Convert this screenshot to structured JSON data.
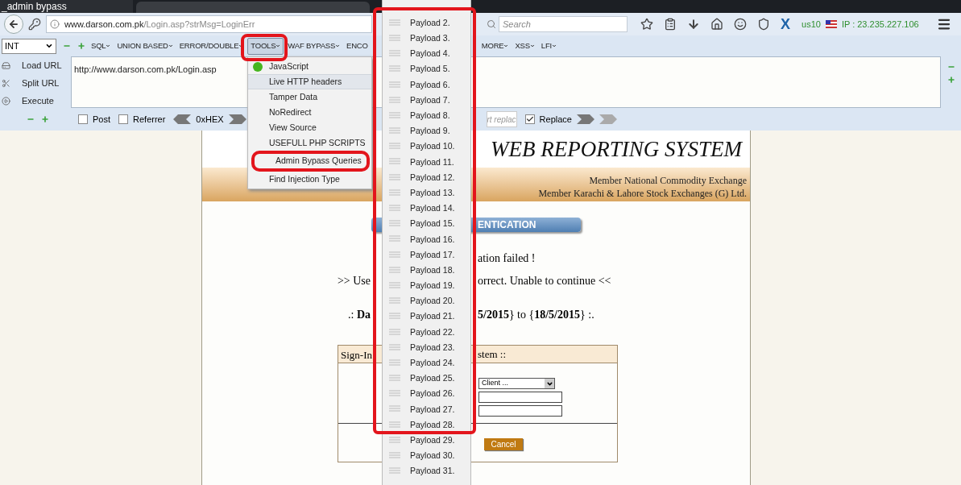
{
  "tab_title": "_admin bypass",
  "address_bar": {
    "host": "www.darson.com.pk",
    "path": "/Login.asp?strMsg=LoginErr"
  },
  "search": {
    "placeholder": "Search"
  },
  "toolbar_logo": "X",
  "vpn": {
    "server": "us10",
    "ip": "IP : 23.235.227.106"
  },
  "hackbar": {
    "select": "INT",
    "menus_left": [
      {
        "label": "SQL",
        "caret": true,
        "selected": false
      },
      {
        "label": "UNION BASED",
        "caret": true,
        "selected": false
      },
      {
        "label": "ERROR/DOUBLE",
        "caret": true,
        "selected": false
      },
      {
        "label": "TOOLS",
        "caret": true,
        "selected": true
      },
      {
        "label": "WAF BYPASS",
        "caret": true,
        "selected": false
      },
      {
        "label": "ENCO",
        "caret": false,
        "selected": false
      }
    ],
    "menus_right": [
      {
        "label": "MORE",
        "caret": true,
        "selected": false
      },
      {
        "label": "XSS",
        "caret": true,
        "selected": false
      },
      {
        "label": "LFI",
        "caret": true,
        "selected": false
      }
    ],
    "actions": [
      {
        "label": "Load URL",
        "kind": "load"
      },
      {
        "label": "Split URL",
        "kind": "split"
      },
      {
        "label": "Execute",
        "kind": "execute"
      }
    ],
    "url_text": "http://www.darson.com.pk/Login.asp",
    "options": [
      {
        "label": "Post",
        "checked": false
      },
      {
        "label": "Referrer",
        "checked": false
      }
    ],
    "hex_label": "0xHEX",
    "replace_field": "rt replac",
    "replace": {
      "label": "Replace",
      "checked": true
    }
  },
  "tools_menu": [
    {
      "label": "JavaScript",
      "kind": "dot",
      "selected": false
    },
    {
      "label": "Live HTTP headers",
      "kind": "plain",
      "selected": true
    },
    {
      "label": "Tamper Data",
      "kind": "plain",
      "selected": false
    },
    {
      "label": "NoRedirect",
      "kind": "plain",
      "selected": false
    },
    {
      "label": "View Source",
      "kind": "plain",
      "selected": false
    },
    {
      "label": "USEFULL PHP SCRIPTS",
      "kind": "plain",
      "selected": false
    },
    {
      "label": "Admin Bypass Queries",
      "kind": "plain",
      "selected": false,
      "circled": true
    },
    {
      "label": "Find Injection Type",
      "kind": "plain",
      "selected": false
    }
  ],
  "payload_menu": [
    "Payload 2.",
    "Payload 3.",
    "Payload 4.",
    "Payload 5.",
    "Payload 6.",
    "Payload 7.",
    "Payload 8.",
    "Payload 9.",
    "Payload 10.",
    "Payload 11.",
    "Payload 12.",
    "Payload 13.",
    "Payload 14.",
    "Payload 15.",
    "Payload 16.",
    "Payload 17.",
    "Payload 18.",
    "Payload 19.",
    "Payload 20.",
    "Payload 21.",
    "Payload 22.",
    "Payload 23.",
    "Payload 24.",
    "Payload 25.",
    "Payload 26.",
    "Payload 27.",
    "Payload 28.",
    "Payload 29.",
    "Payload 30.",
    "Payload 31."
  ],
  "page": {
    "title": "WEB REPORTING SYSTEM",
    "members": [
      "Member National Commodity Exchange",
      "Member Karachi & Lahore Stock Exchanges (G) Ltd."
    ],
    "banner": "ENTICATION",
    "message_lines": [
      {
        "right": "ation failed !"
      },
      {
        "left": ">> Use",
        "right": "orrect. Unable to continue <<"
      },
      {
        "left": ".: **Da**",
        "right": "**5/2015**} to {**18/5/2015**} :."
      }
    ],
    "signin": {
      "title_left": "Sign-In",
      "title_right": "stem ::",
      "select": "Client ...",
      "button": "Cancel"
    }
  }
}
